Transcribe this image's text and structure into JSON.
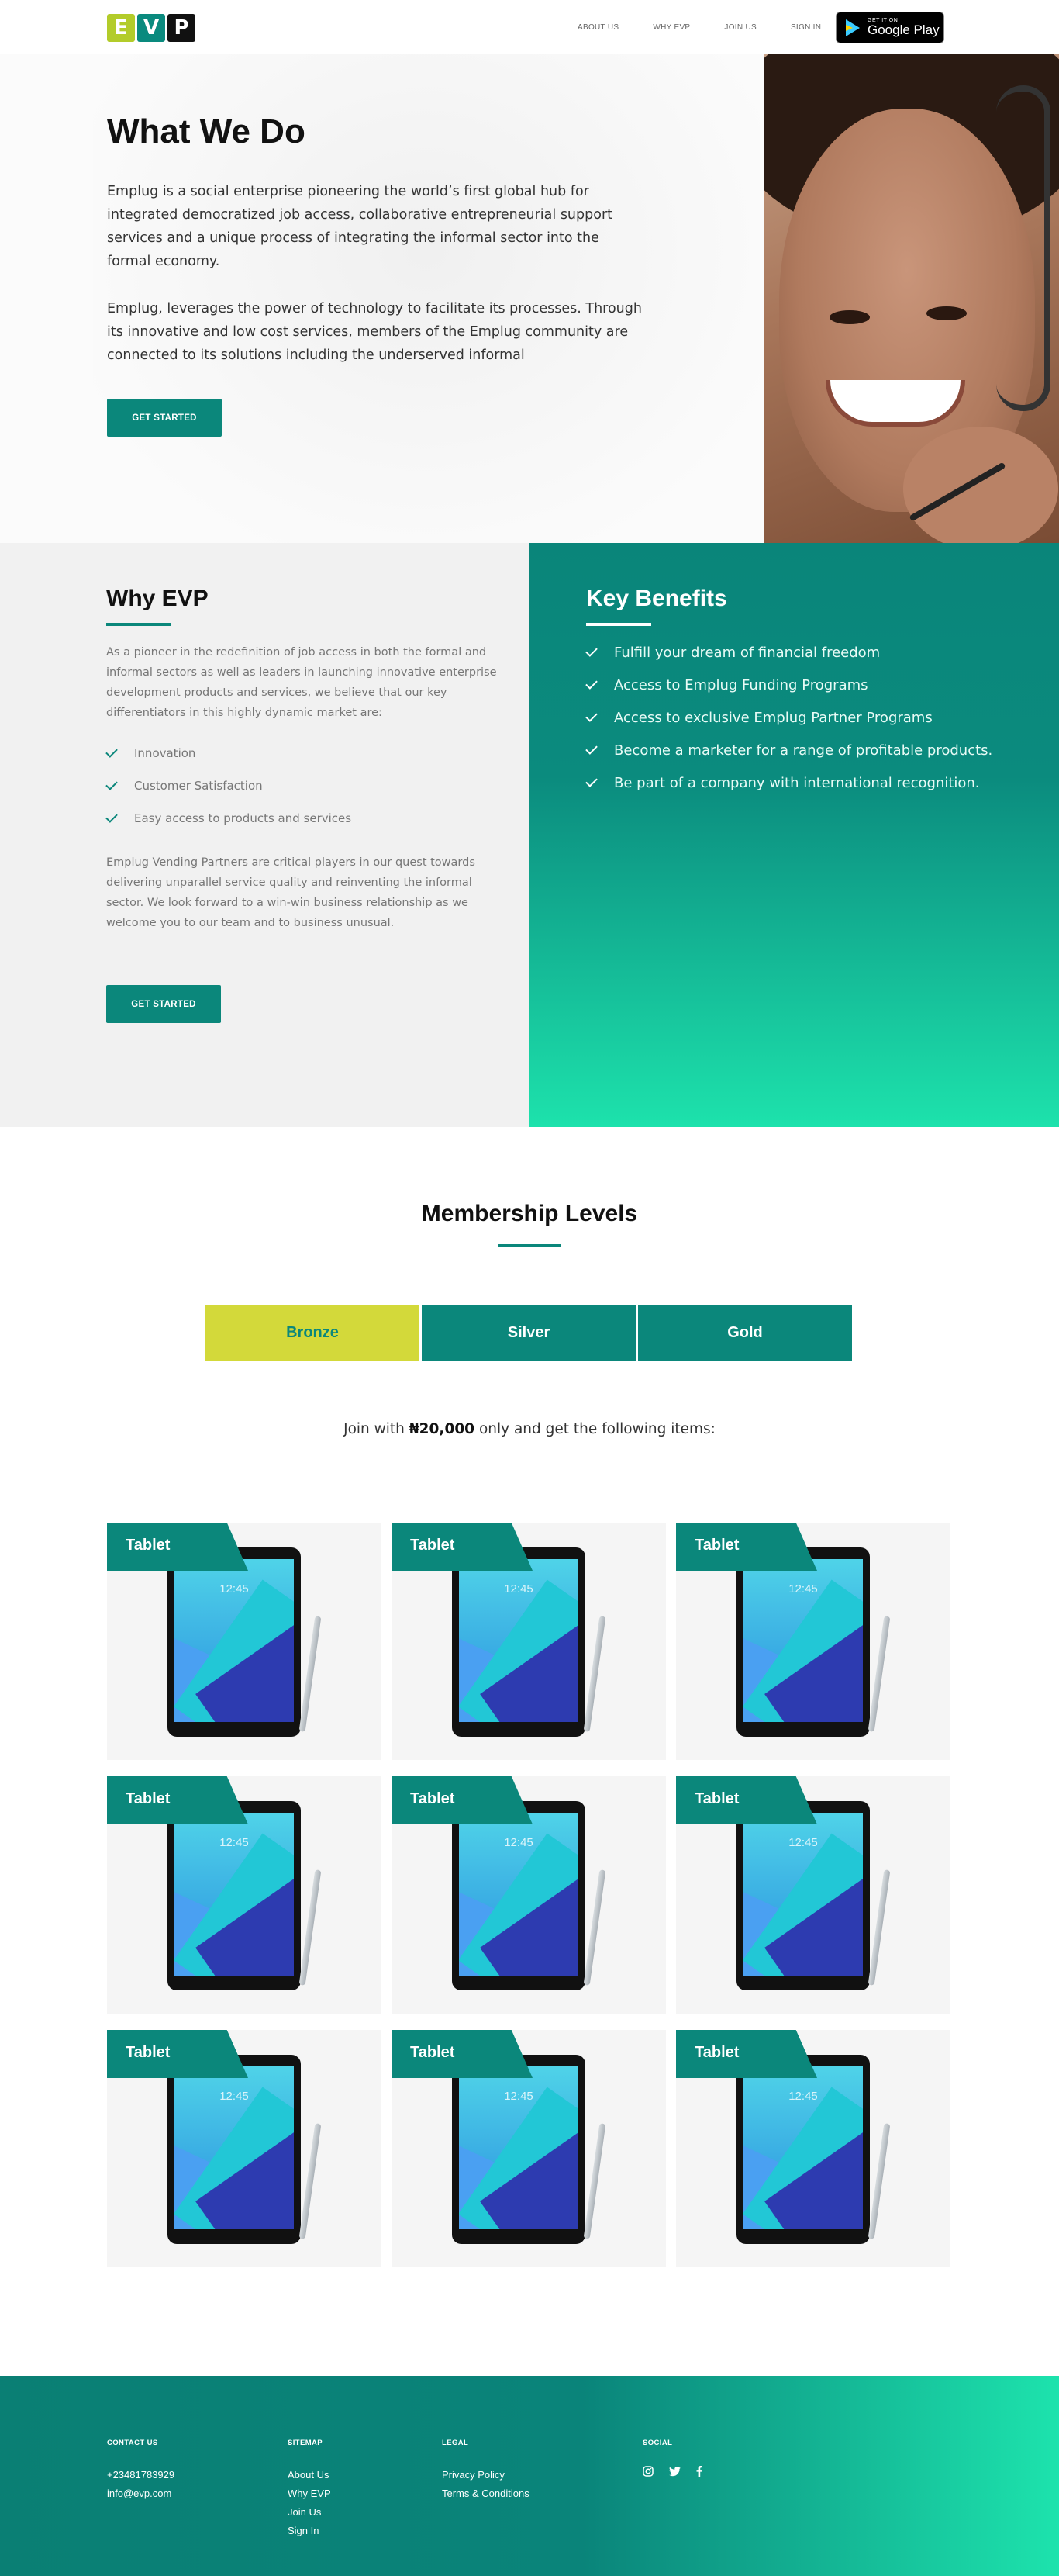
{
  "header": {
    "logo_letters": [
      "E",
      "V",
      "P"
    ],
    "nav": [
      "ABOUT US",
      "WHY EVP",
      "JOIN US",
      "SIGN IN"
    ],
    "store_badge": {
      "small": "GET IT ON",
      "big": "Google Play"
    }
  },
  "hero": {
    "title": "What We Do",
    "p1": "Emplug is a social enterprise pioneering the world’s first global hub for integrated democratized job access, collaborative entrepreneurial support services and a unique process of integrating the informal sector into the formal economy.",
    "p2": "Emplug, leverages the power of technology to facilitate its processes. Through its innovative and low cost services, members of the Emplug community are connected to its solutions including the underserved informal",
    "button": "GET STARTED"
  },
  "why": {
    "title": "Why EVP",
    "p1": "As a pioneer in the redefinition of job access in both the formal and informal sectors as well as leaders in launching innovative enterprise development products and services, we believe that our key differentiators in this highly dynamic market are:",
    "items": [
      "Innovation",
      "Customer Satisfaction",
      "Easy access to products and services"
    ],
    "p2": "Emplug Vending Partners are critical players in our quest towards delivering unparallel service quality and reinventing the informal sector. We look forward to a win-win business relationship as we welcome you to our team and to business unusual.",
    "button": "GET STARTED"
  },
  "benefits": {
    "title": "Key Benefits",
    "items": [
      "Fulfill your dream of financial freedom",
      "Access to Emplug Funding Programs",
      "Access to exclusive Emplug Partner Programs",
      "Become a marketer for a range of profitable products.",
      "Be part of a company with international recognition."
    ]
  },
  "membership": {
    "title": "Membership Levels",
    "tabs": [
      "Bronze",
      "Silver",
      "Gold"
    ],
    "active_tab": "Bronze",
    "join_prefix": "Join with ",
    "join_amount": "₦20,000",
    "join_suffix": " only and get the following items:",
    "items": [
      "Tablet",
      "Tablet",
      "Tablet",
      "Tablet",
      "Tablet",
      "Tablet",
      "Tablet",
      "Tablet",
      "Tablet"
    ],
    "tablet_clock": "12:45"
  },
  "footer": {
    "contact": {
      "heading": "CONTACT US",
      "phone": "+23481783929",
      "email": "info@evp.com"
    },
    "sitemap": {
      "heading": "SITEMAP",
      "links": [
        "About Us",
        "Why EVP",
        "Join Us",
        "Sign In"
      ]
    },
    "legal": {
      "heading": "LEGAL",
      "links": [
        "Privacy Policy",
        "Terms & Conditions"
      ]
    },
    "social": {
      "heading": "SOCIAL",
      "icons": [
        "instagram-icon",
        "twitter-icon",
        "facebook-icon"
      ]
    }
  },
  "colors": {
    "primary": "#0b877b",
    "accent": "#d3d93a",
    "gradient_end": "#1de2ac"
  }
}
